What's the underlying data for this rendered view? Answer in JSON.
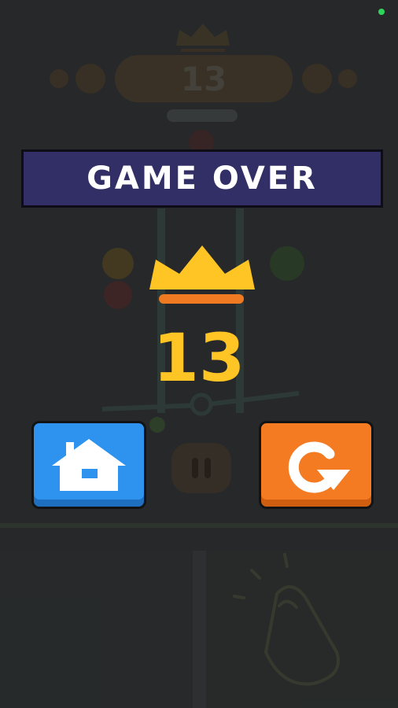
{
  "status": {
    "indicator_color": "#2fd55a"
  },
  "background": {
    "ghost_score": "13",
    "ghost_pill_text": "● ◐ ●"
  },
  "game_over": {
    "title": "GAME OVER",
    "score": "13",
    "colors": {
      "banner": "#322f66",
      "crown": "#ffc524",
      "crown_underline": "#f07a21",
      "score": "#ffc524",
      "home_button": "#2e93ef",
      "replay_button": "#f57b22"
    }
  },
  "buttons": {
    "home": {
      "icon": "home-icon"
    },
    "replay": {
      "icon": "replay-icon"
    }
  }
}
